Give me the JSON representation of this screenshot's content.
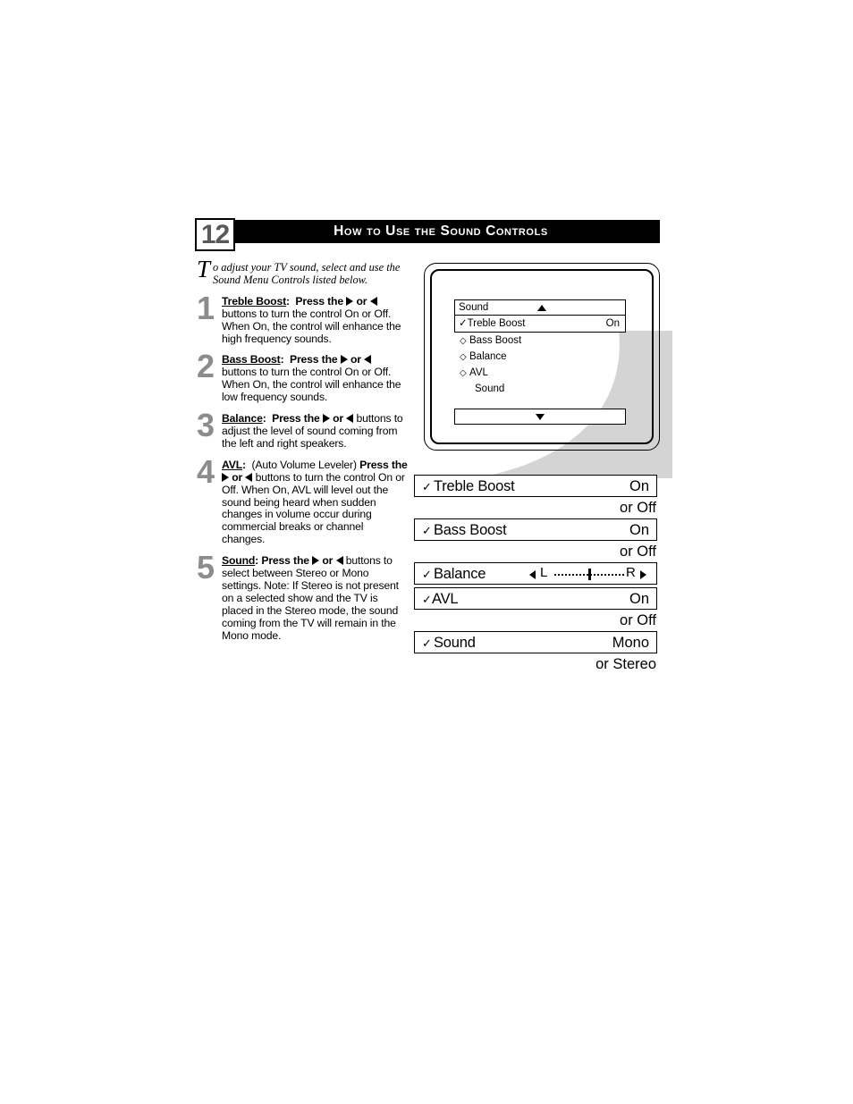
{
  "header": {
    "page_number": "12",
    "title": "How to Use the Sound Controls"
  },
  "intro": {
    "dropcap": "T",
    "text": "o adjust your TV sound, select and use the Sound Menu Controls listed below."
  },
  "steps": [
    {
      "number": "1",
      "term": "Treble Boost",
      "colon": ":",
      "press_the": "Press the",
      "or": "or",
      "rest": "buttons to turn the control On or Off. When On, the control will enhance the high frequency sounds."
    },
    {
      "number": "2",
      "term": "Bass Boost",
      "colon": ":",
      "press_the": "Press the",
      "or": "or",
      "rest": "buttons to turn the control On or Off. When On, the control will enhance the low frequency sounds."
    },
    {
      "number": "3",
      "term": "Balance",
      "colon": ":",
      "press_the": "Press the",
      "or": "or",
      "rest": "buttons to adjust the level of sound coming from the left and right speakers."
    },
    {
      "number": "4",
      "term": "AVL",
      "colon": ":",
      "paren": "(Auto Volume Leveler)",
      "press_the": "Press the",
      "or": "or",
      "rest": "buttons to turn the control On or Off. When On, AVL will level out the sound being heard when sudden changes in volume occur during commercial breaks or channel changes."
    },
    {
      "number": "5",
      "term": "Sound",
      "colon": ":",
      "press_the": "Press the",
      "or": "or",
      "rest": "buttons to select between Stereo or Mono settings. Note: If Stereo is not present on a selected show and the TV is placed in the Stereo mode, the sound coming from the TV will remain in the Mono mode."
    }
  ],
  "tv_menu": {
    "header_label": "Sound",
    "up_arrow_icon": "triangle-up-icon",
    "down_arrow_icon": "triangle-down-icon",
    "selected_item": {
      "check": "✓",
      "label": "Treble Boost",
      "value": "On"
    },
    "items": [
      {
        "bullet": "◇",
        "label": "Bass Boost"
      },
      {
        "bullet": "◇",
        "label": "Balance"
      },
      {
        "bullet": "◇",
        "label": "AVL"
      },
      {
        "bullet": "",
        "label": "Sound"
      }
    ]
  },
  "osd_bars": [
    {
      "check": "✓",
      "label": "Treble Boost",
      "value": "On",
      "sub": "or Off"
    },
    {
      "check": "✓",
      "label": "Bass Boost",
      "value": "On",
      "sub": "or Off"
    },
    {
      "check": "✓",
      "label": "Balance",
      "left_marker": "L",
      "right_marker": "R",
      "left_arrow_icon": "triangle-left-icon",
      "right_arrow_icon": "triangle-right-icon",
      "sub": ""
    },
    {
      "check": "✓",
      "label": "AVL",
      "value": "On",
      "sub": "or Off"
    },
    {
      "check": "✓",
      "label": "Sound",
      "value": "Mono",
      "sub": "or Stereo"
    }
  ],
  "colors": {
    "header_band": "#000000",
    "page_number": "#58595b",
    "step_number": "#8c8c8e",
    "swoosh": "#d3d3d3",
    "text": "#000000"
  }
}
